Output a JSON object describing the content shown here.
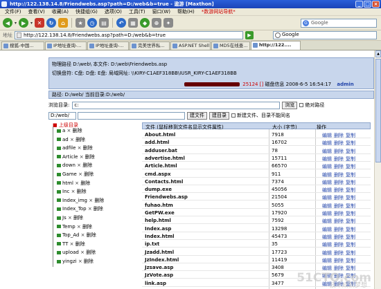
{
  "window": {
    "title": "http://122.138.14.8/Friendwebs.asp?path=D:/web&b=true - 遨游 [Maxthon]"
  },
  "menu": [
    "文件(F)",
    "查看(V)",
    "收藏(A)",
    "快捷组(G)",
    "选项(O)",
    "工具(T)",
    "窗口(W)",
    "帮助(H)",
    "*数游网站导航*"
  ],
  "toolbar": {
    "search_placeholder": "Google"
  },
  "address": {
    "label": "地址",
    "url": "http://122.138.14.8/Friendwebs.asp?path=D:/web&b=true",
    "search_label": "Google"
  },
  "tabs": [
    {
      "label": "搜狐-中国..."
    },
    {
      "label": "IP地址查询-..."
    },
    {
      "label": "IP地址查询-..."
    },
    {
      "label": "完美世界私..."
    },
    {
      "label": "ASP.NET Shell"
    },
    {
      "label": "MD5在线查..."
    },
    {
      "label": "http://122...."
    }
  ],
  "info": {
    "line1": "物理路径 D:\\web\\ 本文件: D:\\web\\Friendwebs.asp",
    "line2": "切换盘符: C盘: D盘: E盘: 局域网址: \\\\KIRY-C1AEF318BB\\IUSR_KIRY-C1AEF318BB",
    "line3_disk": "25124 []",
    "line3_rest": "磁盘信息 2008-6-5 16:54:17",
    "user": "admin"
  },
  "path_row": "路径: D:/web/ 当前目录:D:/web/",
  "browse": {
    "label": "浏览目录:",
    "value": "c:",
    "button": "浏览",
    "link": "绝对路径"
  },
  "newfile": {
    "dir_value": "D:/web/",
    "btn_file": "建文件",
    "btn_dir": "建目录",
    "cb_label": "新建文件、目录不能同名"
  },
  "tree": {
    "up": "上级目录",
    "items": [
      {
        "name": "a",
        "del": "删除"
      },
      {
        "name": "ad",
        "del": "删除"
      },
      {
        "name": "adfile",
        "del": "删除"
      },
      {
        "name": "Article",
        "del": "删除"
      },
      {
        "name": "down",
        "del": "删除"
      },
      {
        "name": "Game",
        "del": "删除"
      },
      {
        "name": "html",
        "del": "删除"
      },
      {
        "name": "Inc",
        "del": "删除"
      },
      {
        "name": "Index_img",
        "del": "删除"
      },
      {
        "name": "Index_Top",
        "del": "删除"
      },
      {
        "name": "Js",
        "del": "删除"
      },
      {
        "name": "Temp",
        "del": "删除"
      },
      {
        "name": "Top_Ad",
        "del": "删除"
      },
      {
        "name": "TT",
        "del": "删除"
      },
      {
        "name": "upload",
        "del": "删除"
      },
      {
        "name": "yingzi",
        "del": "删除"
      }
    ]
  },
  "table": {
    "col_file": "文件 (鼠标移到文件名显示文件属性)",
    "col_size": "大小 (字节)",
    "col_ops": "操作",
    "ops": [
      "编辑",
      "删除",
      "复制"
    ],
    "rows": [
      {
        "name": "About.html",
        "size": "7918"
      },
      {
        "name": "add.html",
        "size": "16702"
      },
      {
        "name": "adduser.bat",
        "size": "78"
      },
      {
        "name": "advertise.html",
        "size": "15711"
      },
      {
        "name": "Article.html",
        "size": "66570"
      },
      {
        "name": "cmd.aspx",
        "size": "911"
      },
      {
        "name": "Contacts.html",
        "size": "7374"
      },
      {
        "name": "dump.exe",
        "size": "45056"
      },
      {
        "name": "Friendwebs.asp",
        "size": "21504"
      },
      {
        "name": "fuhao.htm",
        "size": "5055"
      },
      {
        "name": "GetPW.exe",
        "size": "17920"
      },
      {
        "name": "help.html",
        "size": "7592"
      },
      {
        "name": "Index.asp",
        "size": "13298"
      },
      {
        "name": "Index.html",
        "size": "45473"
      },
      {
        "name": "ip.txt",
        "size": "35"
      },
      {
        "name": "Jzadd.html",
        "size": "17723"
      },
      {
        "name": "JzIndex.html",
        "size": "11419"
      },
      {
        "name": "Jzsave.asp",
        "size": "3408"
      },
      {
        "name": "JzVote.asp",
        "size": "5679"
      },
      {
        "name": "link.asp",
        "size": "3477"
      }
    ]
  },
  "watermark": {
    "text": "51CTO.com",
    "sub": "技术成就梦想"
  }
}
